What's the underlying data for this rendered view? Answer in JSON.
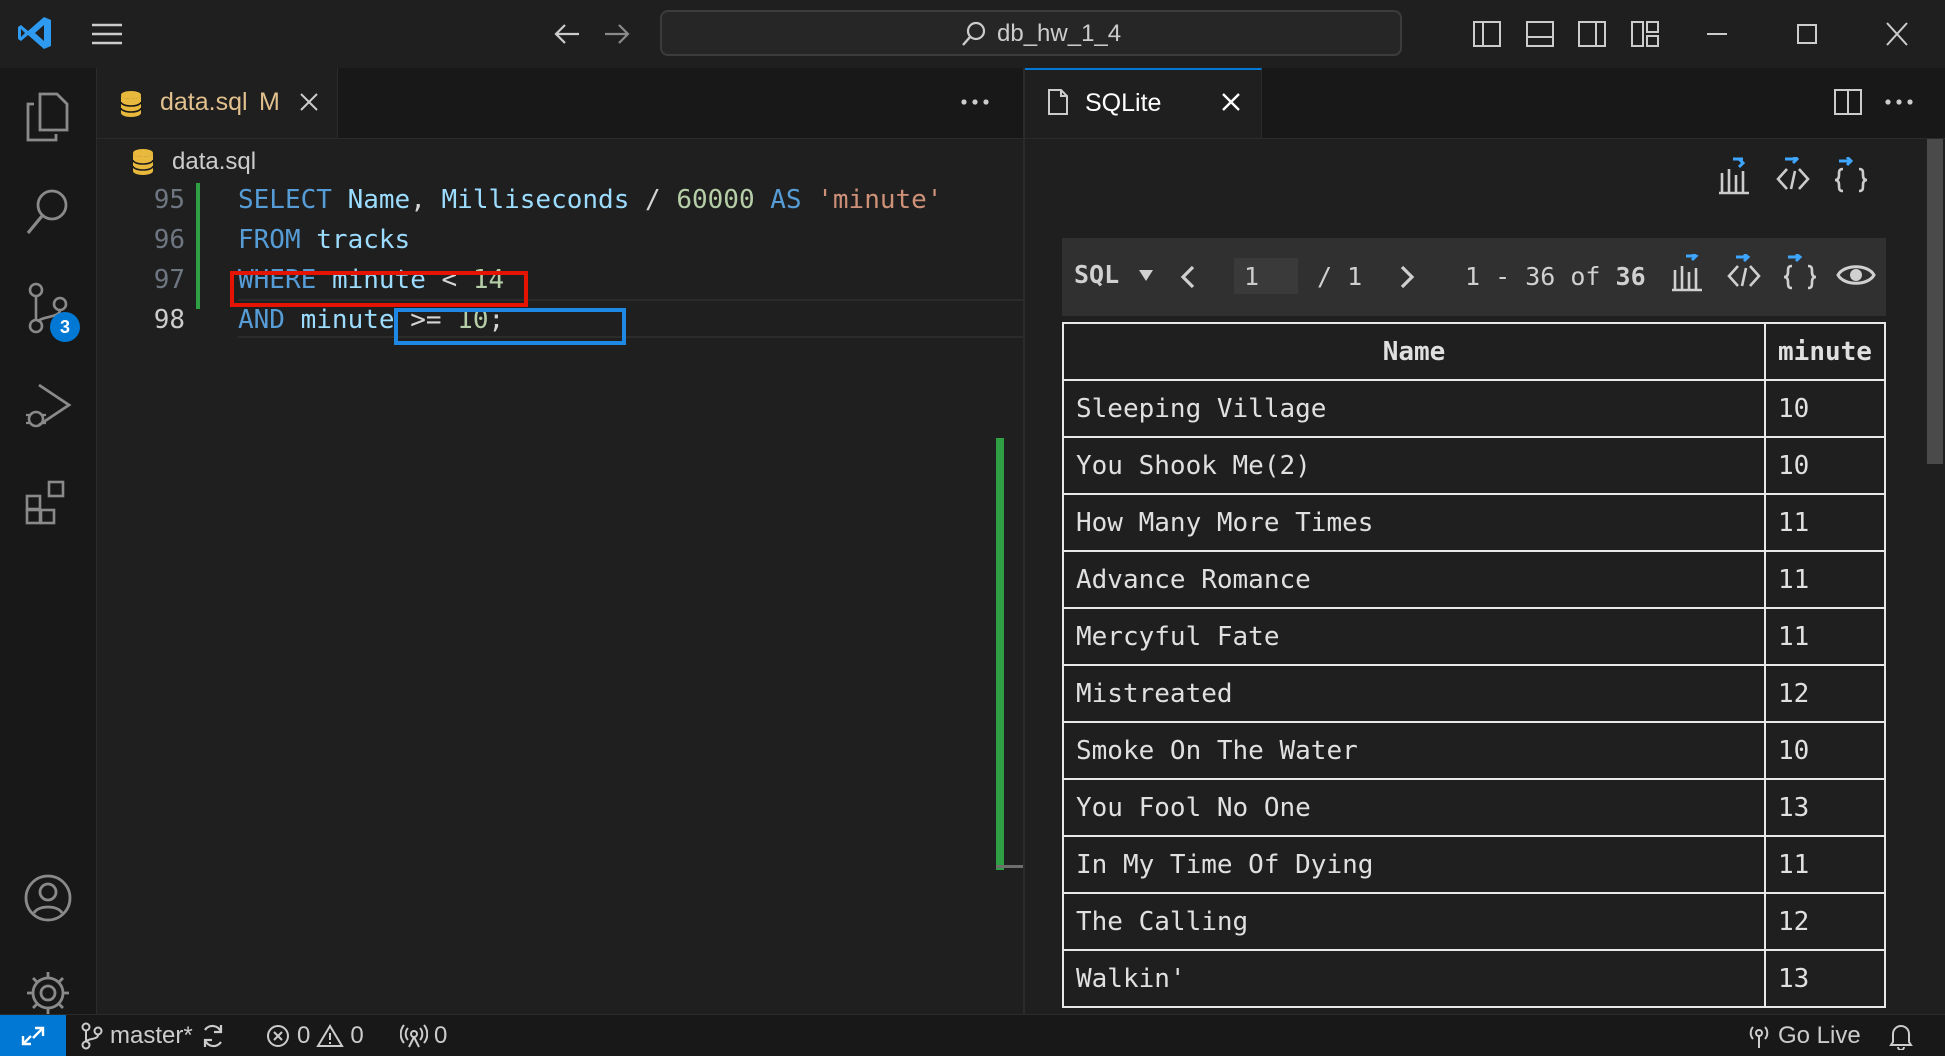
{
  "titlebar": {
    "search_text": "db_hw_1_4"
  },
  "activity_bar": {
    "source_control_badge": "3"
  },
  "editor": {
    "tab": {
      "filename": "data.sql",
      "status": "M"
    },
    "breadcrumb": "data.sql",
    "lines": [
      {
        "number": "95",
        "tokens": [
          {
            "t": "SELECT",
            "c": "kw"
          },
          {
            "t": " ",
            "c": "op"
          },
          {
            "t": "Name",
            "c": "id"
          },
          {
            "t": ", ",
            "c": "op"
          },
          {
            "t": "Milliseconds",
            "c": "id"
          },
          {
            "t": " / ",
            "c": "op"
          },
          {
            "t": "60000",
            "c": "num"
          },
          {
            "t": " ",
            "c": "op"
          },
          {
            "t": "AS",
            "c": "kw"
          },
          {
            "t": " ",
            "c": "op"
          },
          {
            "t": "'minute'",
            "c": "str"
          }
        ]
      },
      {
        "number": "96",
        "tokens": [
          {
            "t": "FROM",
            "c": "kw"
          },
          {
            "t": " ",
            "c": "op"
          },
          {
            "t": "tracks",
            "c": "id"
          }
        ]
      },
      {
        "number": "97",
        "tokens": [
          {
            "t": "WHERE",
            "c": "kw"
          },
          {
            "t": " ",
            "c": "op"
          },
          {
            "t": "minute",
            "c": "id"
          },
          {
            "t": " < ",
            "c": "op"
          },
          {
            "t": "14",
            "c": "num"
          }
        ]
      },
      {
        "number": "98",
        "tokens": [
          {
            "t": "AND",
            "c": "kw"
          },
          {
            "t": " ",
            "c": "op"
          },
          {
            "t": "minute",
            "c": "id"
          },
          {
            "t": " >= ",
            "c": "op"
          },
          {
            "t": "10",
            "c": "num"
          },
          {
            "t": ";",
            "c": "op"
          }
        ]
      }
    ]
  },
  "sqlite_panel": {
    "tab_title": "SQLite",
    "mode": "SQL",
    "page_current": "1",
    "page_total": "/ 1",
    "range_text": "1 - 36 of ",
    "total_rows": "36",
    "columns": [
      "Name",
      "minute"
    ],
    "rows": [
      [
        "Sleeping Village",
        "10"
      ],
      [
        "You Shook Me(2)",
        "10"
      ],
      [
        "How Many More Times",
        "11"
      ],
      [
        "Advance Romance",
        "11"
      ],
      [
        "Mercyful Fate",
        "11"
      ],
      [
        "Mistreated",
        "12"
      ],
      [
        "Smoke On The Water",
        "10"
      ],
      [
        "You Fool No One",
        "13"
      ],
      [
        "In My Time Of Dying",
        "11"
      ],
      [
        "The Calling",
        "12"
      ],
      [
        "Walkin'",
        "13"
      ]
    ]
  },
  "statusbar": {
    "branch": "master*",
    "errors": "0",
    "warnings": "0",
    "ports": "0",
    "go_live": "Go Live"
  },
  "colors": {
    "accent": "#0078d4",
    "highlight_red": "#e51400",
    "highlight_blue": "#1e88e5",
    "modified_gutter": "#2ea043"
  }
}
